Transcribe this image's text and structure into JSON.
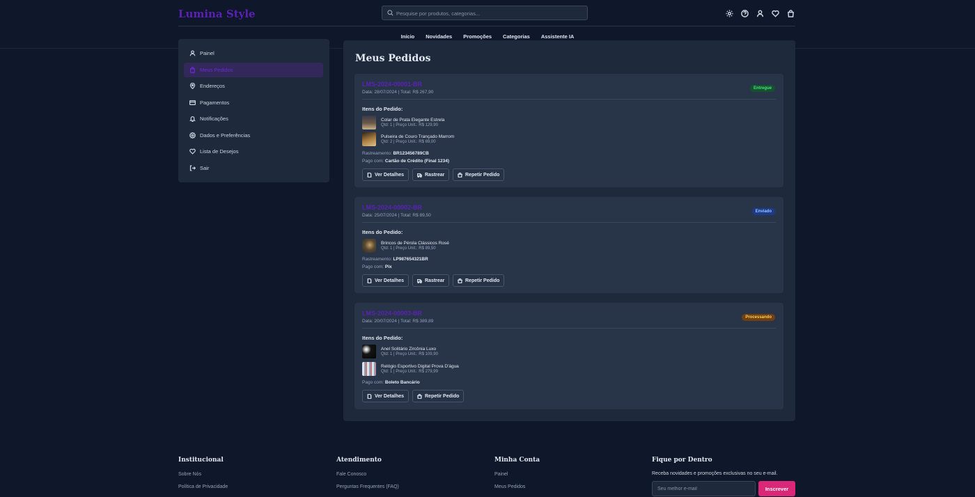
{
  "header": {
    "logo": "Lumina Style",
    "search_placeholder": "Pesquise por produtos, categorias...",
    "icons": [
      "sun-icon",
      "help-icon",
      "user-icon",
      "heart-icon",
      "cart-icon"
    ],
    "nav": [
      "Início",
      "Novidades",
      "Promoções",
      "Categorias",
      "Assistente IA"
    ]
  },
  "sidebar": {
    "items": [
      {
        "label": "Painel",
        "icon": "user-icon"
      },
      {
        "label": "Meus Pedidos",
        "icon": "bag-icon",
        "active": true
      },
      {
        "label": "Endereços",
        "icon": "map-pin-icon"
      },
      {
        "label": "Pagamentos",
        "icon": "credit-card-icon"
      },
      {
        "label": "Notificações",
        "icon": "bell-icon"
      },
      {
        "label": "Dados e Preferências",
        "icon": "gear-icon"
      },
      {
        "label": "Lista de Desejos",
        "icon": "heart-icon"
      },
      {
        "label": "Sair",
        "icon": "logout-icon"
      }
    ]
  },
  "main": {
    "title": "Meus Pedidos",
    "items_label": "Itens do Pedido:",
    "tracking_label": "Rastreamento:",
    "paid_label": "Pago com:",
    "orders": [
      {
        "id": "LMS-2024-00001-BR",
        "meta": "Data: 28/07/2024 | Total: R$ 267,90",
        "status": "Entregue",
        "items": [
          {
            "name": "Colar de Prata Elegante Estrela",
            "qty": "Qtd: 1 | Preço Unit.: R$ 129,90"
          },
          {
            "name": "Pulseira de Couro Trançado Marrom",
            "qty": "Qtd: 2 | Preço Unit.: R$ 69,00"
          }
        ],
        "tracking": "BR123456789CB",
        "paid": "Cartão de Crédito (Final 1234)",
        "buttons": [
          "Ver Detalhes",
          "Rastrear",
          "Repetir Pedido"
        ]
      },
      {
        "id": "LMS-2024-00002-BR",
        "meta": "Data: 25/07/2024 | Total: R$ 89,50",
        "status": "Enviado",
        "items": [
          {
            "name": "Brincos de Pérola Clássicos Rosé",
            "qty": "Qtd: 1 | Preço Unit.: R$ 89,50"
          }
        ],
        "tracking": "LP987654321BR",
        "paid": "Pix",
        "buttons": [
          "Ver Detalhes",
          "Rastrear",
          "Repetir Pedido"
        ]
      },
      {
        "id": "LMS-2024-00003-BR",
        "meta": "Data: 20/07/2024 | Total: R$ 389,89",
        "status": "Processando",
        "items": [
          {
            "name": "Anel Solitário Zircônia Luxo",
            "qty": "Qtd: 1 | Preço Unit.: R$ 109,90"
          },
          {
            "name": "Relógio Esportivo Digital Prova D'água",
            "qty": "Qtd: 1 | Preço Unit.: R$ 279,99"
          }
        ],
        "paid": "Boleto Bancário",
        "buttons": [
          "Ver Detalhes",
          "Repetir Pedido"
        ]
      }
    ]
  },
  "footer": {
    "institucional": {
      "title": "Institucional",
      "links": [
        "Sobre Nós",
        "Política de Privacidade"
      ]
    },
    "atendimento": {
      "title": "Atendimento",
      "links": [
        "Fale Conosco",
        "Perguntas Frequentes (FAQ)"
      ]
    },
    "minha_conta": {
      "title": "Minha Conta",
      "links": [
        "Painel",
        "Meus Pedidos"
      ]
    },
    "newsletter": {
      "title": "Fique por Dentro",
      "desc": "Receba novidades e promoções exclusivas no seu e-mail.",
      "placeholder": "Seu melhor e-mail",
      "button": "Inscrever"
    }
  },
  "colors": {
    "background": "#0f172a",
    "card": "#1e293b",
    "accent": "#5b21b6",
    "cta": "#db2777"
  }
}
